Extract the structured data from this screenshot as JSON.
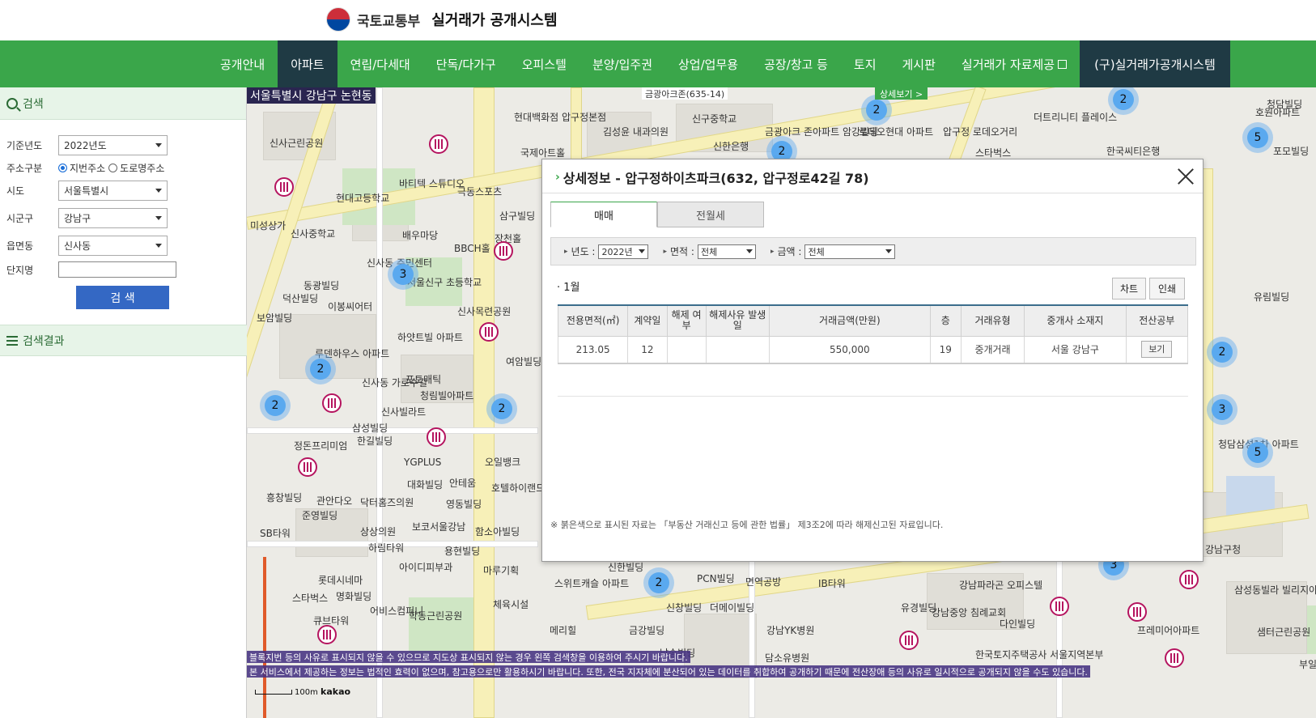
{
  "header": {
    "ministry": "국토교통부",
    "system": "실거래가 공개시스템"
  },
  "nav": {
    "items": [
      "공개안내",
      "아파트",
      "연립/다세대",
      "단독/다가구",
      "오피스텔",
      "분양/입주권",
      "상업/업무용",
      "공장/창고 등",
      "토지",
      "게시판",
      "실거래가 자료제공"
    ],
    "active": "아파트",
    "legacy": "(구)실거래가공개시스템"
  },
  "sidebar": {
    "search_title": "검색",
    "fields": {
      "year_label": "기준년도",
      "year_value": "2022년도",
      "addr_label": "주소구분",
      "addr_jibun": "지번주소",
      "addr_road": "도로명주소",
      "sido_label": "시도",
      "sido_value": "서울특별시",
      "sigungu_label": "시군구",
      "sigungu_value": "강남구",
      "dong_label": "읍면동",
      "dong_value": "신사동",
      "complex_label": "단지명",
      "complex_value": ""
    },
    "search_button": "검 색",
    "results_title": "검색결과"
  },
  "map": {
    "region": "서울특별시 강남구 논현동",
    "addr_tip": "금광아크존(635-14)",
    "detail_button": "상세보기 >",
    "notice1": "블록지번 등의 사유로 표시되지 않을 수 있으므로 지도상 표시되지 않는 경우 왼쪽 검색창을 이용하여 주시기 바랍니다.",
    "notice2": "본 서비스에서 제공하는 정보는 법적인 효력이 없으며, 참고용으로만 활용하시기 바랍니다. 또한, 전국 지자체에 분산되어 있는 데이터를 취합하여 공개하기 때문에 전산장애 등의 사유로 일시적으로 공개되지 않을 수도 있습니다.",
    "scale": "100m",
    "brand": "kakao",
    "labels": [
      {
        "t": "신사근린공원"
      },
      {
        "t": "현대고등학교"
      },
      {
        "t": "미성상가"
      },
      {
        "t": "신사중학교"
      },
      {
        "t": "신사동 주민센터"
      },
      {
        "t": "배우마당"
      },
      {
        "t": "BBCH홀"
      },
      {
        "t": "장천홀"
      },
      {
        "t": "서울신구 초등학교"
      },
      {
        "t": "동광빌딩"
      },
      {
        "t": "덕산빌딩"
      },
      {
        "t": "이봉씨어터"
      },
      {
        "t": "보암빌딩"
      },
      {
        "t": "하얏트빌 아파트"
      },
      {
        "t": "신사목련공원"
      },
      {
        "t": "여암빌딩"
      },
      {
        "t": "루덴하우스 아파트"
      },
      {
        "t": "포토매틱"
      },
      {
        "t": "신사동 가로수길"
      },
      {
        "t": "청림빌아파트"
      },
      {
        "t": "신사빌라트"
      },
      {
        "t": "삼성빌딩"
      },
      {
        "t": "한길빌딩"
      },
      {
        "t": "정돈프리미엄"
      },
      {
        "t": "YGPLUS"
      },
      {
        "t": "오일뱅크"
      },
      {
        "t": "대화빌딩"
      },
      {
        "t": "안테움"
      },
      {
        "t": "호텔하이랜드"
      },
      {
        "t": "흥창빌딩"
      },
      {
        "t": "관안다오"
      },
      {
        "t": "닥터홈즈의원"
      },
      {
        "t": "영동빌딩"
      },
      {
        "t": "준영빌딩"
      },
      {
        "t": "SB타워"
      },
      {
        "t": "상상의원"
      },
      {
        "t": "보코서울강남"
      },
      {
        "t": "함소아빌딩"
      },
      {
        "t": "하림타워"
      },
      {
        "t": "용현빌딩"
      },
      {
        "t": "아이디피부과"
      },
      {
        "t": "마루기획"
      },
      {
        "t": "롯데시네마"
      },
      {
        "t": "명화빌딩"
      },
      {
        "t": "스타벅스"
      },
      {
        "t": "어비스컴퍼니"
      },
      {
        "t": "학동근린공원"
      },
      {
        "t": "체육시설"
      },
      {
        "t": "큐브타워"
      },
      {
        "t": "신한빌딩"
      },
      {
        "t": "스위트캐슬 아파트"
      },
      {
        "t": "PCN빌딩"
      },
      {
        "t": "면역공방"
      },
      {
        "t": "IB타워"
      },
      {
        "t": "신창빌딩"
      },
      {
        "t": "더메이빌딩"
      },
      {
        "t": "금강빌딩"
      },
      {
        "t": "메리힐"
      },
      {
        "t": "남송빌딩"
      },
      {
        "t": "강남YK병원"
      },
      {
        "t": "담소유병원"
      },
      {
        "t": "유경빌딩"
      },
      {
        "t": "강남중앙 침례교회"
      },
      {
        "t": "다인빌딩"
      },
      {
        "t": "강남파라곤 오피스텔"
      },
      {
        "t": "한국토지주택공사 서울지역본부"
      },
      {
        "t": "삼성동빌라 빌리지아파트"
      },
      {
        "t": "프레미어아파트"
      },
      {
        "t": "샘터근린공원"
      },
      {
        "t": "부일빌딩"
      },
      {
        "t": "강남구청"
      },
      {
        "t": "청담삼성1차 아파트"
      },
      {
        "t": "유림빌딩"
      },
      {
        "t": "호원아파트"
      },
      {
        "t": "포모빌딩"
      },
      {
        "t": "한국씨티은행"
      },
      {
        "t": "스타벅스"
      },
      {
        "t": "더트리니티 플레이스"
      },
      {
        "t": "신구중학교"
      },
      {
        "t": "김성윤 내과의원"
      },
      {
        "t": "신한은행"
      },
      {
        "t": "금광아크 존아파트"
      },
      {
        "t": "암강빌딩"
      },
      {
        "t": "로데오현대 아파트"
      },
      {
        "t": "압구정 로데오거리"
      },
      {
        "t": "국제아트홀"
      },
      {
        "t": "바티텍 스튜디오"
      },
      {
        "t": "극동스포츠"
      },
      {
        "t": "삼구빌딩"
      },
      {
        "t": "현대백화점 압구정본점"
      },
      {
        "t": "청담빌딩"
      }
    ],
    "clusters": [
      "2",
      "2",
      "2",
      "5",
      "3",
      "2",
      "2",
      "2",
      "3",
      "5",
      "2",
      "3",
      "2"
    ]
  },
  "modal": {
    "title": "상세정보 - 압구정하이츠파크(632, 압구정로42길 78)",
    "tabs": [
      "매매",
      "전월세"
    ],
    "filters": {
      "year_label": "년도 :",
      "year_value": "2022년",
      "area_label": "면적 :",
      "area_value": "전체",
      "price_label": "금액 :",
      "price_value": "전체"
    },
    "month": "· 1월",
    "chart_button": "차트",
    "print_button": "인쇄",
    "table": {
      "headers": [
        "전용면적(㎡)",
        "계약일",
        "해제 여부",
        "해제사유 발생일",
        "거래금액(만원)",
        "층",
        "거래유형",
        "중개사 소재지",
        "전산공부"
      ],
      "rows": [
        [
          "213.05",
          "12",
          "",
          "",
          "550,000",
          "19",
          "중개거래",
          "서울 강남구",
          "보기"
        ]
      ]
    },
    "footnote": "※ 붉은색으로 표시된 자료는 「부동산 거래신고 등에 관한 법률」 제3조2에 따라 해제신고된 자료입니다."
  }
}
